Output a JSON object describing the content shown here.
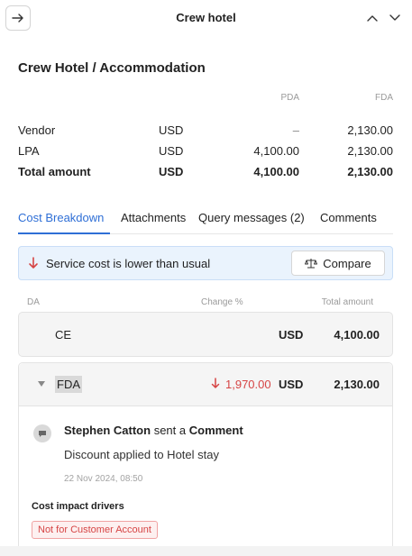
{
  "header": {
    "title": "Crew hotel",
    "back_icon": "arrow-right-icon",
    "up_icon": "chevron-up-icon",
    "down_icon": "chevron-down-icon"
  },
  "section": {
    "title": "Crew Hotel / Accommodation"
  },
  "cost_table": {
    "columns": {
      "pda": "PDA",
      "fda": "FDA"
    },
    "rows": [
      {
        "label": "Vendor",
        "currency": "USD",
        "pda": "–",
        "fda": "2,130.00"
      },
      {
        "label": "LPA",
        "currency": "USD",
        "pda": "4,100.00",
        "fda": "2,130.00"
      },
      {
        "label": "Total amount",
        "currency": "USD",
        "pda": "4,100.00",
        "fda": "2,130.00"
      }
    ]
  },
  "tabs": [
    {
      "label": "Cost Breakdown",
      "active": true
    },
    {
      "label": "Attachments",
      "active": false
    },
    {
      "label": "Query messages (2)",
      "active": false
    },
    {
      "label": "Comments",
      "active": false
    }
  ],
  "alert": {
    "text": "Service cost is lower than usual",
    "compare_label": "Compare",
    "accent": "#d64545"
  },
  "list": {
    "columns": {
      "da": "DA",
      "change": "Change %",
      "total": "Total amount"
    },
    "rows": [
      {
        "name": "CE",
        "change": "",
        "currency": "USD",
        "amount": "4,100.00",
        "expanded": false
      },
      {
        "name": "FDA",
        "change": "1,970.00",
        "currency": "USD",
        "amount": "2,130.00",
        "expanded": true
      }
    ]
  },
  "comment": {
    "author": "Stephen Catton",
    "action_prefix": "sent a",
    "action": "Comment",
    "text": "Discount applied to Hotel stay",
    "time": "22 Nov 2024, 08:50"
  },
  "drivers": {
    "label": "Cost impact drivers",
    "tags": [
      "Not for Customer Account"
    ]
  },
  "colors": {
    "accent_blue": "#2f6fd6",
    "negative_red": "#d64545",
    "alert_bg": "#eaf3fd"
  }
}
